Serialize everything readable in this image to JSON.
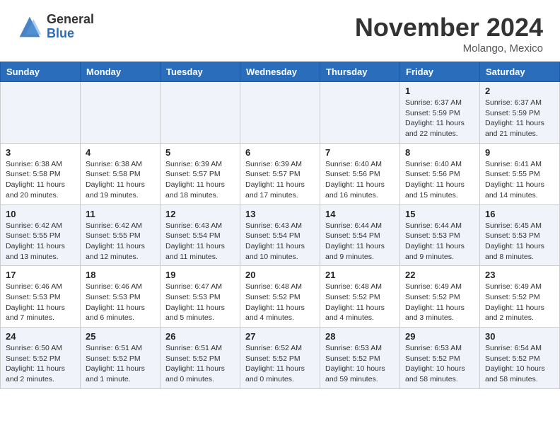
{
  "header": {
    "logo_general": "General",
    "logo_blue": "Blue",
    "month_title": "November 2024",
    "location": "Molango, Mexico"
  },
  "weekdays": [
    "Sunday",
    "Monday",
    "Tuesday",
    "Wednesday",
    "Thursday",
    "Friday",
    "Saturday"
  ],
  "weeks": [
    [
      {
        "day": "",
        "sunrise": "",
        "sunset": "",
        "daylight": ""
      },
      {
        "day": "",
        "sunrise": "",
        "sunset": "",
        "daylight": ""
      },
      {
        "day": "",
        "sunrise": "",
        "sunset": "",
        "daylight": ""
      },
      {
        "day": "",
        "sunrise": "",
        "sunset": "",
        "daylight": ""
      },
      {
        "day": "",
        "sunrise": "",
        "sunset": "",
        "daylight": ""
      },
      {
        "day": "1",
        "sunrise": "Sunrise: 6:37 AM",
        "sunset": "Sunset: 5:59 PM",
        "daylight": "Daylight: 11 hours and 22 minutes."
      },
      {
        "day": "2",
        "sunrise": "Sunrise: 6:37 AM",
        "sunset": "Sunset: 5:59 PM",
        "daylight": "Daylight: 11 hours and 21 minutes."
      }
    ],
    [
      {
        "day": "3",
        "sunrise": "Sunrise: 6:38 AM",
        "sunset": "Sunset: 5:58 PM",
        "daylight": "Daylight: 11 hours and 20 minutes."
      },
      {
        "day": "4",
        "sunrise": "Sunrise: 6:38 AM",
        "sunset": "Sunset: 5:58 PM",
        "daylight": "Daylight: 11 hours and 19 minutes."
      },
      {
        "day": "5",
        "sunrise": "Sunrise: 6:39 AM",
        "sunset": "Sunset: 5:57 PM",
        "daylight": "Daylight: 11 hours and 18 minutes."
      },
      {
        "day": "6",
        "sunrise": "Sunrise: 6:39 AM",
        "sunset": "Sunset: 5:57 PM",
        "daylight": "Daylight: 11 hours and 17 minutes."
      },
      {
        "day": "7",
        "sunrise": "Sunrise: 6:40 AM",
        "sunset": "Sunset: 5:56 PM",
        "daylight": "Daylight: 11 hours and 16 minutes."
      },
      {
        "day": "8",
        "sunrise": "Sunrise: 6:40 AM",
        "sunset": "Sunset: 5:56 PM",
        "daylight": "Daylight: 11 hours and 15 minutes."
      },
      {
        "day": "9",
        "sunrise": "Sunrise: 6:41 AM",
        "sunset": "Sunset: 5:55 PM",
        "daylight": "Daylight: 11 hours and 14 minutes."
      }
    ],
    [
      {
        "day": "10",
        "sunrise": "Sunrise: 6:42 AM",
        "sunset": "Sunset: 5:55 PM",
        "daylight": "Daylight: 11 hours and 13 minutes."
      },
      {
        "day": "11",
        "sunrise": "Sunrise: 6:42 AM",
        "sunset": "Sunset: 5:55 PM",
        "daylight": "Daylight: 11 hours and 12 minutes."
      },
      {
        "day": "12",
        "sunrise": "Sunrise: 6:43 AM",
        "sunset": "Sunset: 5:54 PM",
        "daylight": "Daylight: 11 hours and 11 minutes."
      },
      {
        "day": "13",
        "sunrise": "Sunrise: 6:43 AM",
        "sunset": "Sunset: 5:54 PM",
        "daylight": "Daylight: 11 hours and 10 minutes."
      },
      {
        "day": "14",
        "sunrise": "Sunrise: 6:44 AM",
        "sunset": "Sunset: 5:54 PM",
        "daylight": "Daylight: 11 hours and 9 minutes."
      },
      {
        "day": "15",
        "sunrise": "Sunrise: 6:44 AM",
        "sunset": "Sunset: 5:53 PM",
        "daylight": "Daylight: 11 hours and 9 minutes."
      },
      {
        "day": "16",
        "sunrise": "Sunrise: 6:45 AM",
        "sunset": "Sunset: 5:53 PM",
        "daylight": "Daylight: 11 hours and 8 minutes."
      }
    ],
    [
      {
        "day": "17",
        "sunrise": "Sunrise: 6:46 AM",
        "sunset": "Sunset: 5:53 PM",
        "daylight": "Daylight: 11 hours and 7 minutes."
      },
      {
        "day": "18",
        "sunrise": "Sunrise: 6:46 AM",
        "sunset": "Sunset: 5:53 PM",
        "daylight": "Daylight: 11 hours and 6 minutes."
      },
      {
        "day": "19",
        "sunrise": "Sunrise: 6:47 AM",
        "sunset": "Sunset: 5:53 PM",
        "daylight": "Daylight: 11 hours and 5 minutes."
      },
      {
        "day": "20",
        "sunrise": "Sunrise: 6:48 AM",
        "sunset": "Sunset: 5:52 PM",
        "daylight": "Daylight: 11 hours and 4 minutes."
      },
      {
        "day": "21",
        "sunrise": "Sunrise: 6:48 AM",
        "sunset": "Sunset: 5:52 PM",
        "daylight": "Daylight: 11 hours and 4 minutes."
      },
      {
        "day": "22",
        "sunrise": "Sunrise: 6:49 AM",
        "sunset": "Sunset: 5:52 PM",
        "daylight": "Daylight: 11 hours and 3 minutes."
      },
      {
        "day": "23",
        "sunrise": "Sunrise: 6:49 AM",
        "sunset": "Sunset: 5:52 PM",
        "daylight": "Daylight: 11 hours and 2 minutes."
      }
    ],
    [
      {
        "day": "24",
        "sunrise": "Sunrise: 6:50 AM",
        "sunset": "Sunset: 5:52 PM",
        "daylight": "Daylight: 11 hours and 2 minutes."
      },
      {
        "day": "25",
        "sunrise": "Sunrise: 6:51 AM",
        "sunset": "Sunset: 5:52 PM",
        "daylight": "Daylight: 11 hours and 1 minute."
      },
      {
        "day": "26",
        "sunrise": "Sunrise: 6:51 AM",
        "sunset": "Sunset: 5:52 PM",
        "daylight": "Daylight: 11 hours and 0 minutes."
      },
      {
        "day": "27",
        "sunrise": "Sunrise: 6:52 AM",
        "sunset": "Sunset: 5:52 PM",
        "daylight": "Daylight: 11 hours and 0 minutes."
      },
      {
        "day": "28",
        "sunrise": "Sunrise: 6:53 AM",
        "sunset": "Sunset: 5:52 PM",
        "daylight": "Daylight: 10 hours and 59 minutes."
      },
      {
        "day": "29",
        "sunrise": "Sunrise: 6:53 AM",
        "sunset": "Sunset: 5:52 PM",
        "daylight": "Daylight: 10 hours and 58 minutes."
      },
      {
        "day": "30",
        "sunrise": "Sunrise: 6:54 AM",
        "sunset": "Sunset: 5:52 PM",
        "daylight": "Daylight: 10 hours and 58 minutes."
      }
    ]
  ]
}
